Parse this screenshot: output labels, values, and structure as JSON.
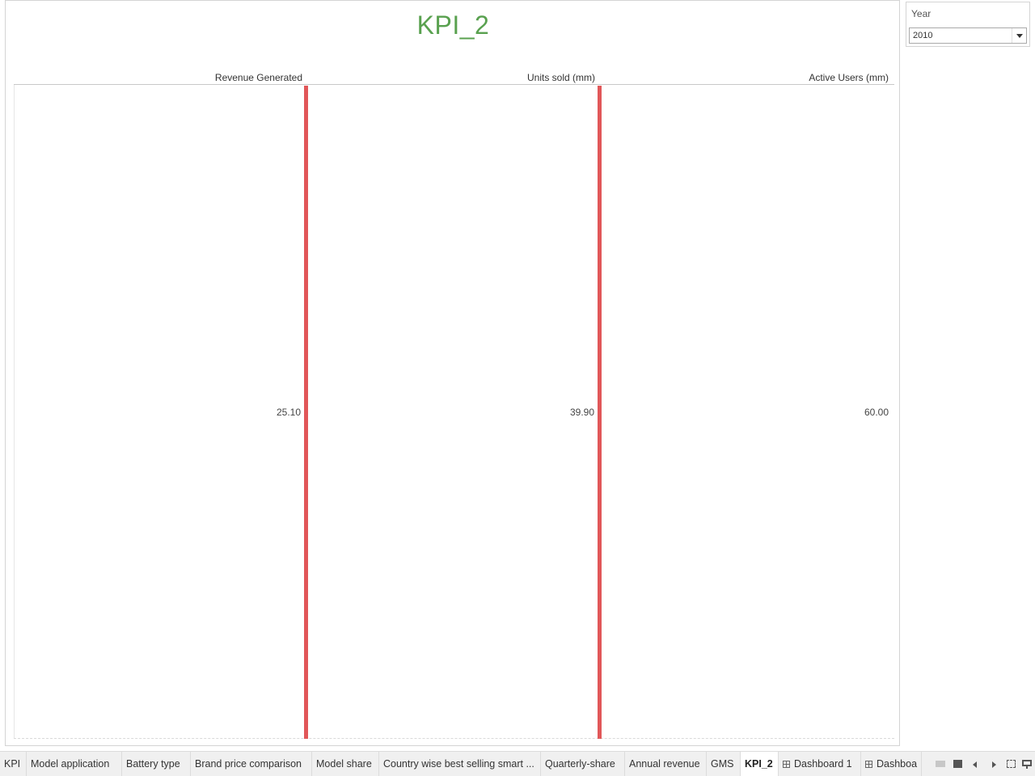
{
  "viz": {
    "title": "KPI_2",
    "title_color": "#59a14f",
    "bar_color": "#e15759"
  },
  "chart_data": {
    "type": "bar",
    "title": "KPI_2",
    "columns": [
      "Revenue Generated",
      "Units sold (mm)",
      "Active Users (mm)"
    ],
    "values": [
      25.1,
      39.9,
      60.0
    ],
    "value_labels": [
      "25.10",
      "39.90",
      "60.00"
    ],
    "bars_visible": [
      true,
      true,
      false
    ]
  },
  "filter": {
    "title": "Year",
    "value": "2010"
  },
  "tabs": [
    {
      "label": "KPI",
      "active": false,
      "dashboard": false
    },
    {
      "label": "Model application",
      "active": false,
      "dashboard": false
    },
    {
      "label": "Battery type",
      "active": false,
      "dashboard": false
    },
    {
      "label": "Brand price comparison",
      "active": false,
      "dashboard": false
    },
    {
      "label": "Model share",
      "active": false,
      "dashboard": false
    },
    {
      "label": "Country wise best selling smart ...",
      "active": false,
      "dashboard": false
    },
    {
      "label": "Quarterly-share",
      "active": false,
      "dashboard": false
    },
    {
      "label": "Annual revenue",
      "active": false,
      "dashboard": false
    },
    {
      "label": "GMS",
      "active": false,
      "dashboard": false
    },
    {
      "label": "KPI_2",
      "active": true,
      "dashboard": false
    },
    {
      "label": "Dashboard 1",
      "active": false,
      "dashboard": true
    },
    {
      "label": "Dashboa",
      "active": false,
      "dashboard": true
    }
  ],
  "tab_controls": [
    "grid-view-icon",
    "slide-view-icon",
    "prev-icon",
    "next-icon",
    "fullscreen-icon",
    "present-icon"
  ]
}
